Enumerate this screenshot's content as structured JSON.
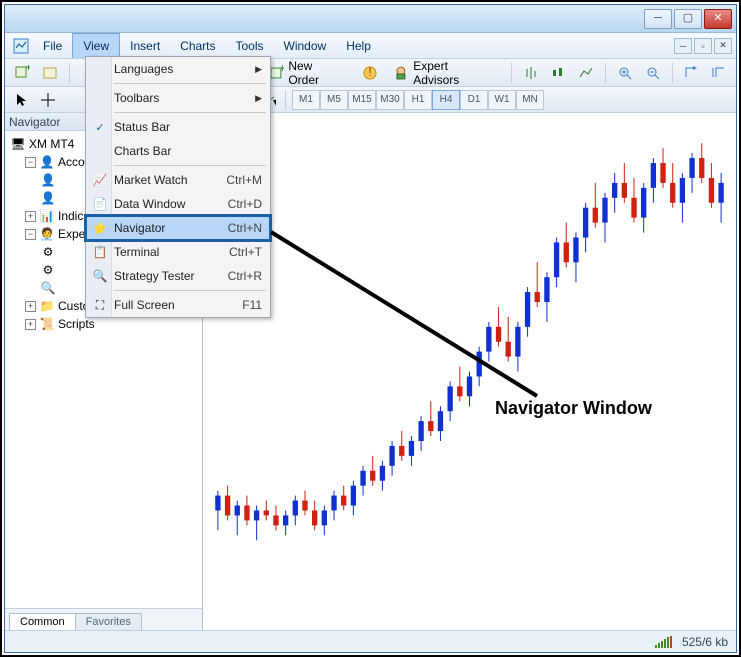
{
  "menubar": {
    "file": "File",
    "view": "View",
    "insert": "Insert",
    "charts": "Charts",
    "tools": "Tools",
    "window": "Window",
    "help": "Help"
  },
  "toolbar": {
    "new_order": "New Order",
    "expert_advisors": "Expert Advisors"
  },
  "timeframes": [
    "M1",
    "M5",
    "M15",
    "M30",
    "H1",
    "H4",
    "D1",
    "W1",
    "MN"
  ],
  "navigator": {
    "title": "Navigator",
    "root": "XM MT4",
    "items": [
      "Accounts",
      "Indicators",
      "Expert Advisors",
      "Custom Indicators",
      "Scripts"
    ],
    "tabs": [
      "Common",
      "Favorites"
    ]
  },
  "view_menu": [
    {
      "label": "Languages"
    },
    {
      "label": "Toolbars"
    },
    {
      "label": "Status Bar"
    },
    {
      "label": "Charts Bar"
    },
    {
      "label": "Market Watch",
      "shortcut": "Ctrl+M"
    },
    {
      "label": "Data Window",
      "shortcut": "Ctrl+D"
    },
    {
      "label": "Navigator",
      "shortcut": "Ctrl+N"
    },
    {
      "label": "Terminal",
      "shortcut": "Ctrl+T"
    },
    {
      "label": "Strategy Tester",
      "shortcut": "Ctrl+R"
    },
    {
      "label": "Full Screen",
      "shortcut": "F11"
    }
  ],
  "status": {
    "traffic": "525/6 kb"
  },
  "annotation": {
    "text": "Navigator Window"
  },
  "chart_data": {
    "type": "candlestick",
    "title": "",
    "ylim": [
      0,
      100
    ],
    "colors": {
      "up": "#1030d0",
      "down": "#d02010"
    },
    "candles": [
      {
        "o": 22,
        "h": 26,
        "l": 18,
        "c": 25,
        "dir": "up"
      },
      {
        "o": 25,
        "h": 27,
        "l": 20,
        "c": 21,
        "dir": "down"
      },
      {
        "o": 21,
        "h": 24,
        "l": 17,
        "c": 23,
        "dir": "up"
      },
      {
        "o": 23,
        "h": 25,
        "l": 19,
        "c": 20,
        "dir": "down"
      },
      {
        "o": 20,
        "h": 23,
        "l": 16,
        "c": 22,
        "dir": "up"
      },
      {
        "o": 22,
        "h": 24,
        "l": 20,
        "c": 21,
        "dir": "down"
      },
      {
        "o": 21,
        "h": 23,
        "l": 18,
        "c": 19,
        "dir": "down"
      },
      {
        "o": 19,
        "h": 22,
        "l": 17,
        "c": 21,
        "dir": "up"
      },
      {
        "o": 21,
        "h": 25,
        "l": 19,
        "c": 24,
        "dir": "up"
      },
      {
        "o": 24,
        "h": 26,
        "l": 21,
        "c": 22,
        "dir": "down"
      },
      {
        "o": 22,
        "h": 24,
        "l": 18,
        "c": 19,
        "dir": "down"
      },
      {
        "o": 19,
        "h": 23,
        "l": 17,
        "c": 22,
        "dir": "up"
      },
      {
        "o": 22,
        "h": 26,
        "l": 20,
        "c": 25,
        "dir": "up"
      },
      {
        "o": 25,
        "h": 27,
        "l": 22,
        "c": 23,
        "dir": "down"
      },
      {
        "o": 23,
        "h": 28,
        "l": 21,
        "c": 27,
        "dir": "up"
      },
      {
        "o": 27,
        "h": 31,
        "l": 25,
        "c": 30,
        "dir": "up"
      },
      {
        "o": 30,
        "h": 33,
        "l": 27,
        "c": 28,
        "dir": "down"
      },
      {
        "o": 28,
        "h": 32,
        "l": 26,
        "c": 31,
        "dir": "up"
      },
      {
        "o": 31,
        "h": 36,
        "l": 29,
        "c": 35,
        "dir": "up"
      },
      {
        "o": 35,
        "h": 38,
        "l": 32,
        "c": 33,
        "dir": "down"
      },
      {
        "o": 33,
        "h": 37,
        "l": 31,
        "c": 36,
        "dir": "up"
      },
      {
        "o": 36,
        "h": 41,
        "l": 34,
        "c": 40,
        "dir": "up"
      },
      {
        "o": 40,
        "h": 44,
        "l": 37,
        "c": 38,
        "dir": "down"
      },
      {
        "o": 38,
        "h": 43,
        "l": 36,
        "c": 42,
        "dir": "up"
      },
      {
        "o": 42,
        "h": 48,
        "l": 40,
        "c": 47,
        "dir": "up"
      },
      {
        "o": 47,
        "h": 51,
        "l": 44,
        "c": 45,
        "dir": "down"
      },
      {
        "o": 45,
        "h": 50,
        "l": 43,
        "c": 49,
        "dir": "up"
      },
      {
        "o": 49,
        "h": 55,
        "l": 47,
        "c": 54,
        "dir": "up"
      },
      {
        "o": 54,
        "h": 60,
        "l": 52,
        "c": 59,
        "dir": "up"
      },
      {
        "o": 59,
        "h": 63,
        "l": 55,
        "c": 56,
        "dir": "down"
      },
      {
        "o": 56,
        "h": 61,
        "l": 52,
        "c": 53,
        "dir": "down"
      },
      {
        "o": 53,
        "h": 60,
        "l": 50,
        "c": 59,
        "dir": "up"
      },
      {
        "o": 59,
        "h": 67,
        "l": 57,
        "c": 66,
        "dir": "up"
      },
      {
        "o": 66,
        "h": 72,
        "l": 63,
        "c": 64,
        "dir": "down"
      },
      {
        "o": 64,
        "h": 70,
        "l": 60,
        "c": 69,
        "dir": "up"
      },
      {
        "o": 69,
        "h": 77,
        "l": 67,
        "c": 76,
        "dir": "up"
      },
      {
        "o": 76,
        "h": 80,
        "l": 71,
        "c": 72,
        "dir": "down"
      },
      {
        "o": 72,
        "h": 78,
        "l": 68,
        "c": 77,
        "dir": "up"
      },
      {
        "o": 77,
        "h": 84,
        "l": 74,
        "c": 83,
        "dir": "up"
      },
      {
        "o": 83,
        "h": 88,
        "l": 79,
        "c": 80,
        "dir": "down"
      },
      {
        "o": 80,
        "h": 86,
        "l": 76,
        "c": 85,
        "dir": "up"
      },
      {
        "o": 85,
        "h": 90,
        "l": 82,
        "c": 88,
        "dir": "up"
      },
      {
        "o": 88,
        "h": 92,
        "l": 84,
        "c": 85,
        "dir": "down"
      },
      {
        "o": 85,
        "h": 89,
        "l": 80,
        "c": 81,
        "dir": "down"
      },
      {
        "o": 81,
        "h": 88,
        "l": 78,
        "c": 87,
        "dir": "up"
      },
      {
        "o": 87,
        "h": 93,
        "l": 84,
        "c": 92,
        "dir": "up"
      },
      {
        "o": 92,
        "h": 95,
        "l": 87,
        "c": 88,
        "dir": "down"
      },
      {
        "o": 88,
        "h": 92,
        "l": 83,
        "c": 84,
        "dir": "down"
      },
      {
        "o": 84,
        "h": 90,
        "l": 80,
        "c": 89,
        "dir": "up"
      },
      {
        "o": 89,
        "h": 94,
        "l": 86,
        "c": 93,
        "dir": "up"
      },
      {
        "o": 93,
        "h": 96,
        "l": 88,
        "c": 89,
        "dir": "down"
      },
      {
        "o": 89,
        "h": 92,
        "l": 83,
        "c": 84,
        "dir": "down"
      },
      {
        "o": 84,
        "h": 90,
        "l": 80,
        "c": 88,
        "dir": "up"
      }
    ]
  }
}
